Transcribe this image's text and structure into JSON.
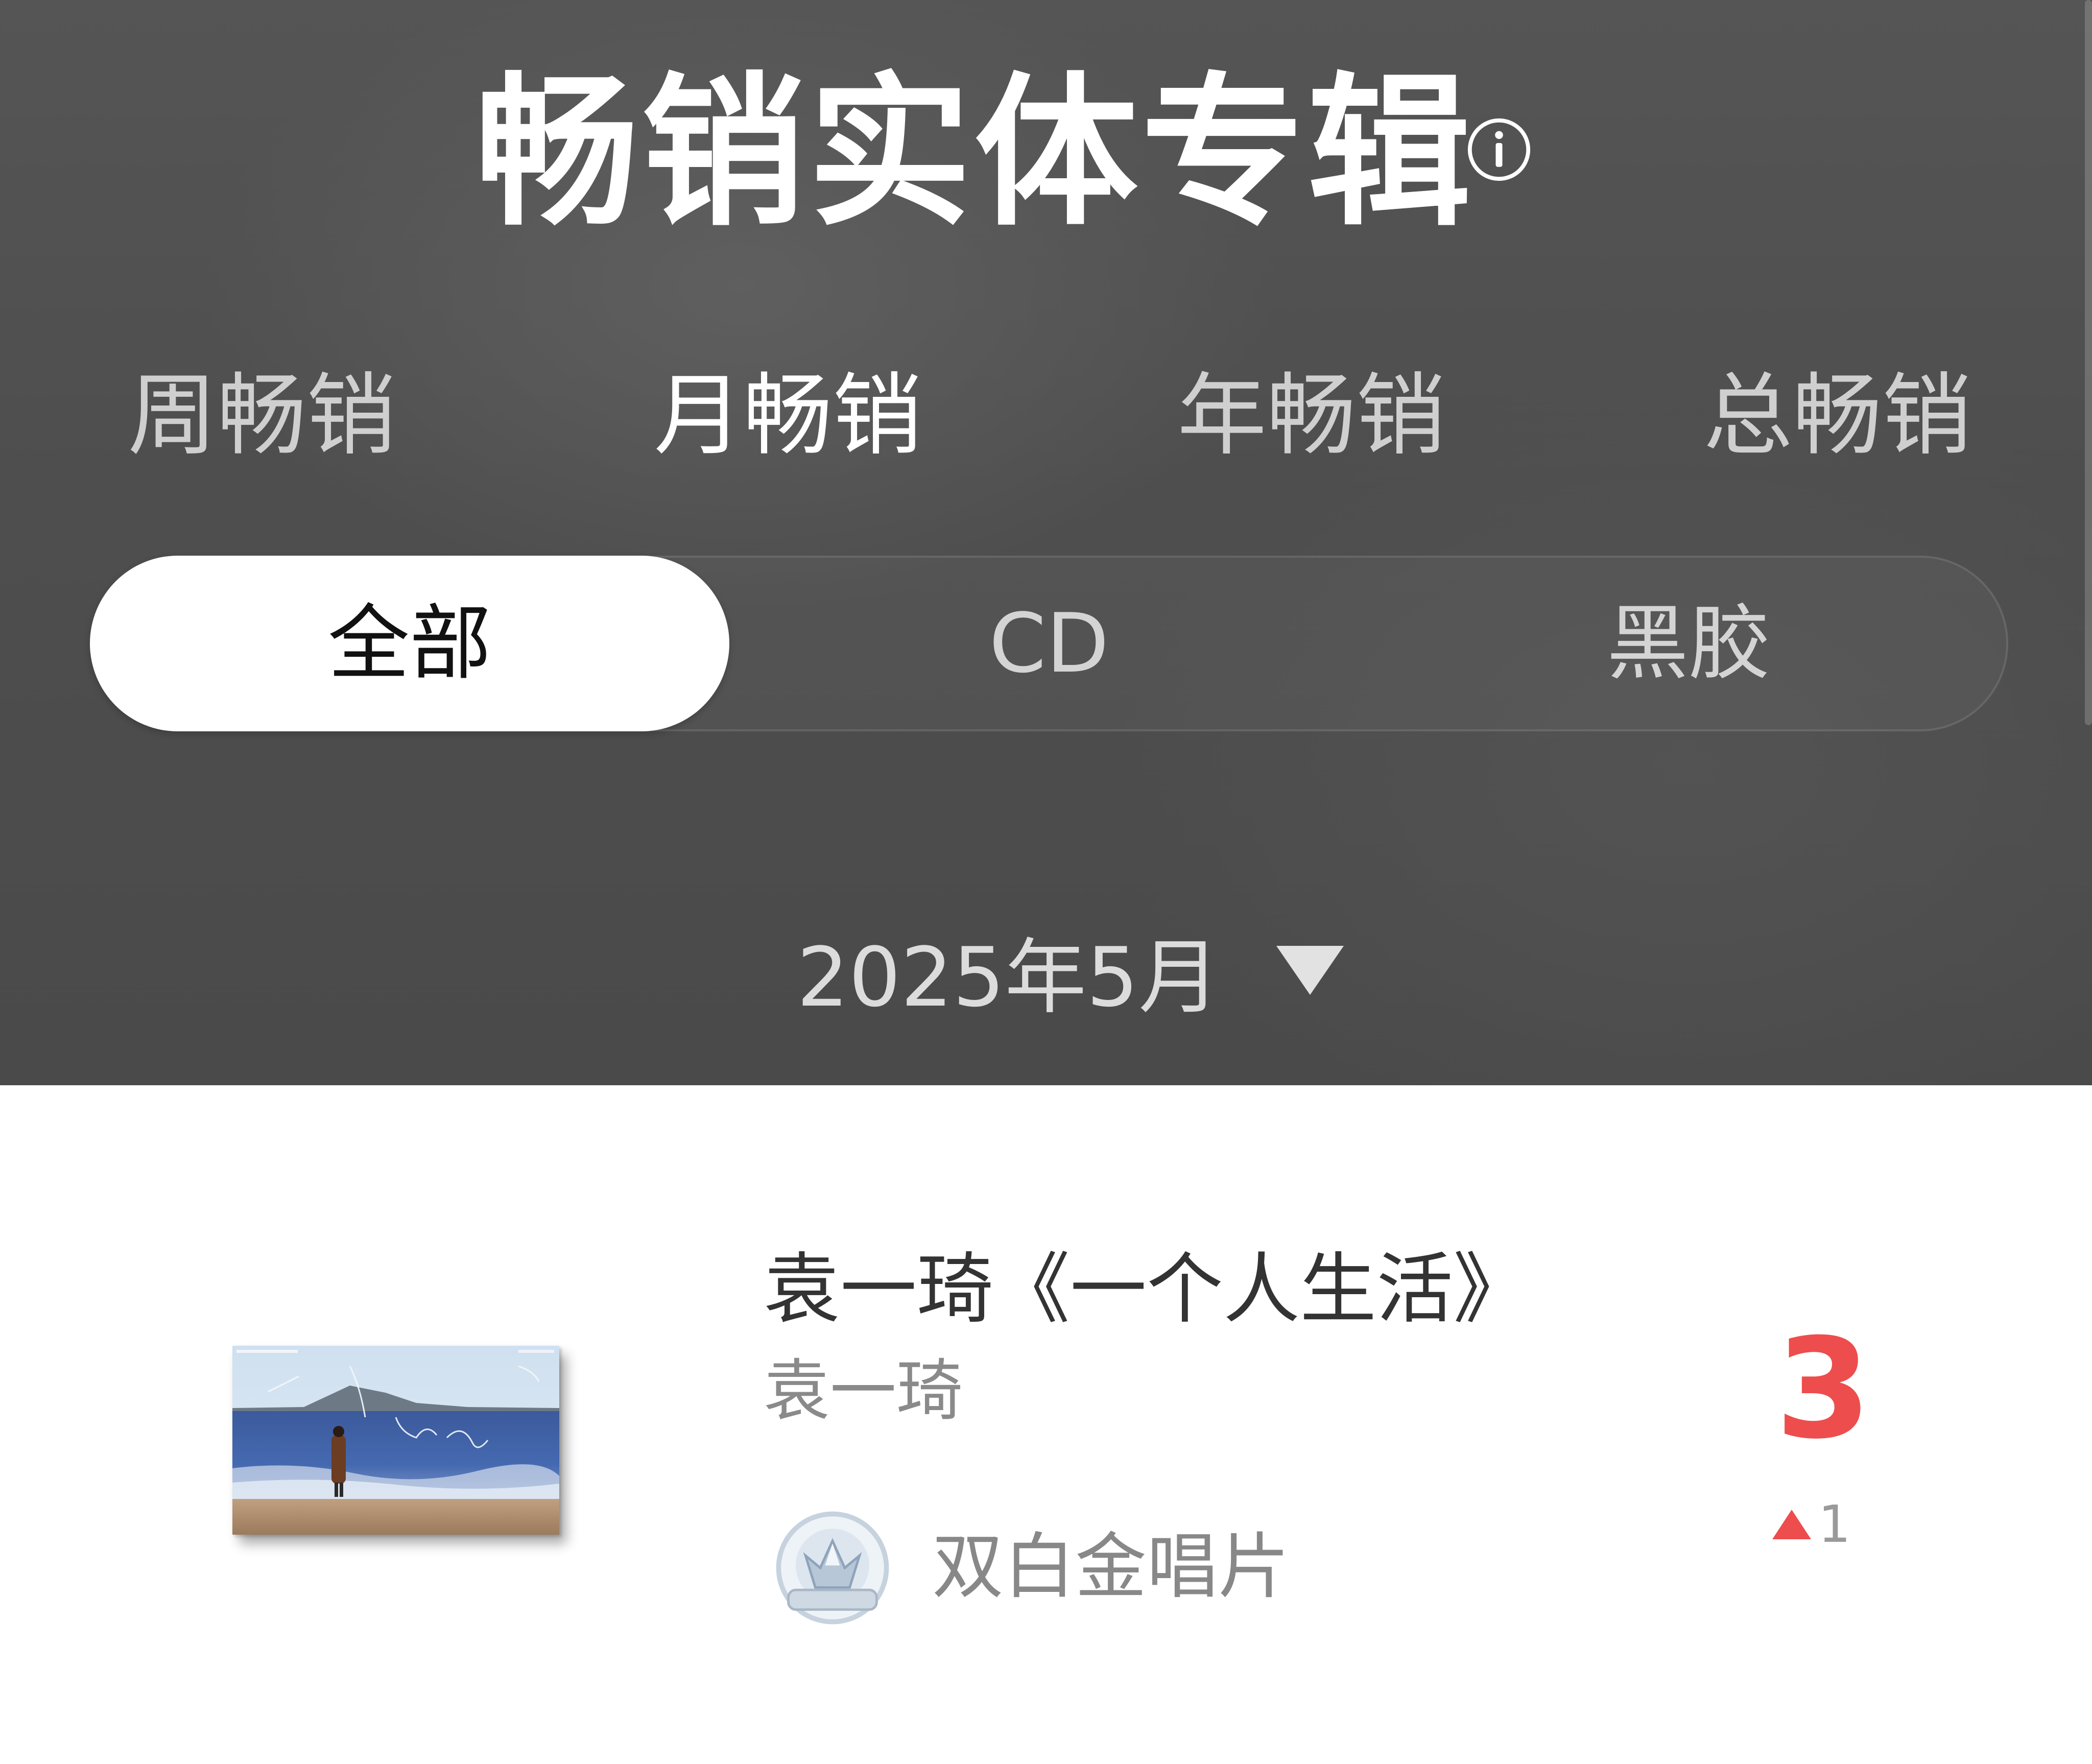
{
  "header": {
    "title": "畅销实体专辑",
    "period_tabs": [
      {
        "label": "周畅销",
        "active": false
      },
      {
        "label": "月畅销",
        "active": true
      },
      {
        "label": "年畅销",
        "active": false
      },
      {
        "label": "总畅销",
        "active": false
      }
    ],
    "format_tabs": [
      {
        "label": "全部",
        "active": true
      },
      {
        "label": "CD",
        "active": false
      },
      {
        "label": "黑胶",
        "active": false
      }
    ],
    "date": "2025年5月"
  },
  "album": {
    "title": "袁一琦《一个人生活》",
    "artist": "袁一琦",
    "certification": "双白金唱片",
    "rank": "3",
    "rank_change": "1",
    "rank_change_direction": "up"
  },
  "icons": {
    "info": "info-icon",
    "dropdown": "triangle-down-icon",
    "rank_up": "triangle-up-icon",
    "badge": "crown-badge-icon"
  },
  "colors": {
    "header_bg": "#4f4f4f",
    "active_pill": "#ffffff",
    "rank_accent": "#ee4d4d"
  }
}
